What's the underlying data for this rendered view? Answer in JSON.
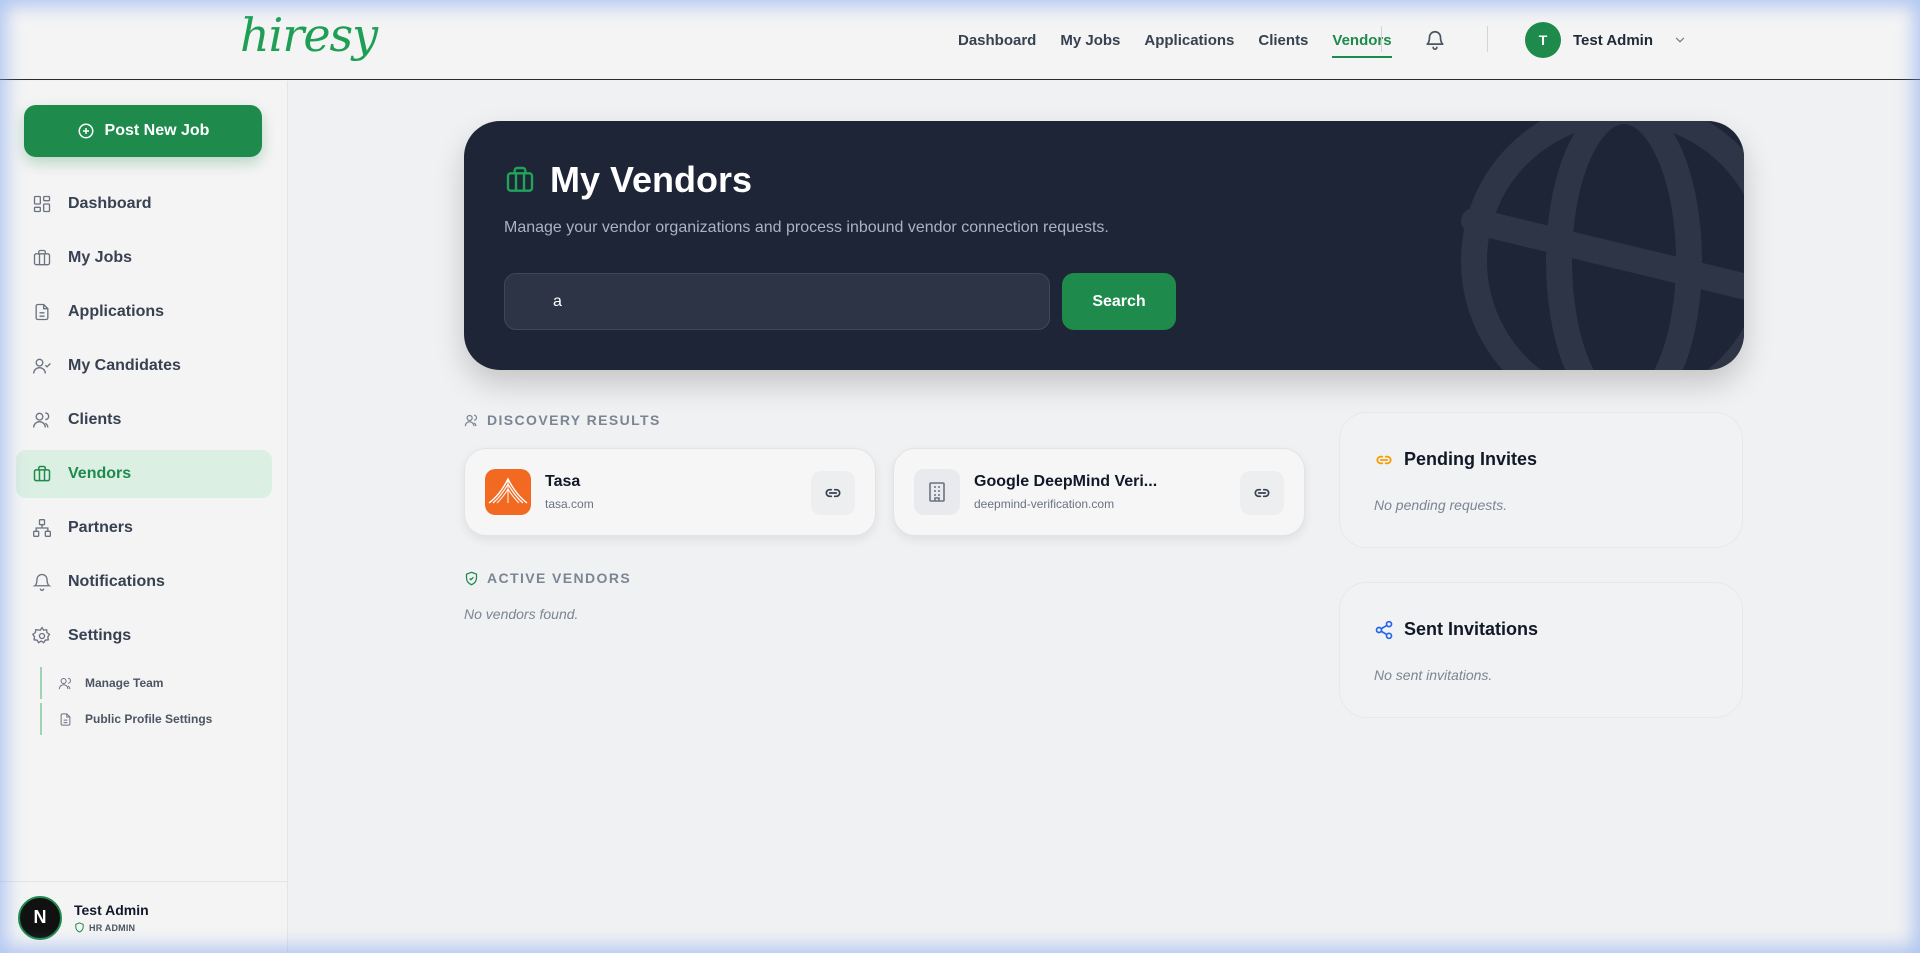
{
  "brand": {
    "logo_text": "hiresy"
  },
  "topnav": {
    "items": [
      {
        "label": "Dashboard",
        "active": false
      },
      {
        "label": "My Jobs",
        "active": false
      },
      {
        "label": "Applications",
        "active": false
      },
      {
        "label": "Clients",
        "active": false
      },
      {
        "label": "Vendors",
        "active": true
      }
    ],
    "user": {
      "initial": "T",
      "name": "Test Admin"
    }
  },
  "sidebar": {
    "post_job_label": "Post New Job",
    "items": [
      {
        "label": "Dashboard",
        "icon": "grid-icon"
      },
      {
        "label": "My Jobs",
        "icon": "briefcase-icon"
      },
      {
        "label": "Applications",
        "icon": "document-icon"
      },
      {
        "label": "My Candidates",
        "icon": "user-check-icon"
      },
      {
        "label": "Clients",
        "icon": "users-icon"
      },
      {
        "label": "Vendors",
        "icon": "briefcase-icon",
        "active": true
      },
      {
        "label": "Partners",
        "icon": "network-icon"
      },
      {
        "label": "Notifications",
        "icon": "bell-icon"
      },
      {
        "label": "Settings",
        "icon": "gear-icon"
      }
    ],
    "sub_items": [
      {
        "label": "Manage Team",
        "icon": "users-icon"
      },
      {
        "label": "Public Profile Settings",
        "icon": "document-icon"
      }
    ],
    "footer": {
      "initial": "N",
      "name": "Test Admin",
      "role": "HR ADMIN"
    }
  },
  "hero": {
    "title": "My Vendors",
    "subtitle": "Manage your vendor organizations and process inbound vendor connection requests.",
    "search_value": "a",
    "search_button": "Search"
  },
  "discovery": {
    "label": "DISCOVERY RESULTS",
    "results": [
      {
        "name": "Tasa",
        "domain": "tasa.com",
        "logo": "tasa-logo"
      },
      {
        "name": "Google DeepMind Veri...",
        "domain": "deepmind-verification.com",
        "logo": "building-icon"
      }
    ]
  },
  "active_vendors": {
    "label": "ACTIVE VENDORS",
    "empty": "No vendors found."
  },
  "pending_invites": {
    "title": "Pending Invites",
    "empty": "No pending requests."
  },
  "sent_invitations": {
    "title": "Sent Invitations",
    "empty": "No sent invitations."
  },
  "colors": {
    "brand_green": "#1e8a4c",
    "hero_bg": "#1e2536",
    "accent_orange": "#f59e0b",
    "accent_blue": "#2563eb"
  }
}
